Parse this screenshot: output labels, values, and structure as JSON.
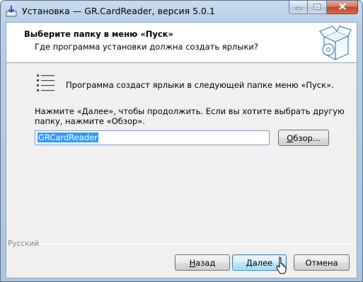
{
  "window": {
    "title": "Установка — GR.CardReader, версия 5.0.1"
  },
  "header": {
    "title": "Выберите папку в меню «Пуск»",
    "subtitle": "Где программа установки должна создать ярлыки?"
  },
  "body": {
    "info": "Программа создаст ярлыки в следующей папке меню «Пуск».",
    "instructions": "Нажмите «Далее», чтобы продолжить. Если вы хотите выбрать другую папку, нажмите «Обзор».",
    "folder_value": "GRCardReader",
    "browse_label": "Обзор..."
  },
  "footer": {
    "language": "Русский",
    "back_label": "Назад",
    "next_label": "Далее",
    "cancel_label": "Отмена"
  },
  "icons": {
    "app": "installer-icon",
    "header_art": "software-box-icon",
    "shortcut": "list-icon",
    "cursor": "mouse-pointer-icon"
  },
  "colors": {
    "selection": "#3399ff",
    "next_button_border": "#3c7fb1",
    "close_button": "#c2452a"
  }
}
